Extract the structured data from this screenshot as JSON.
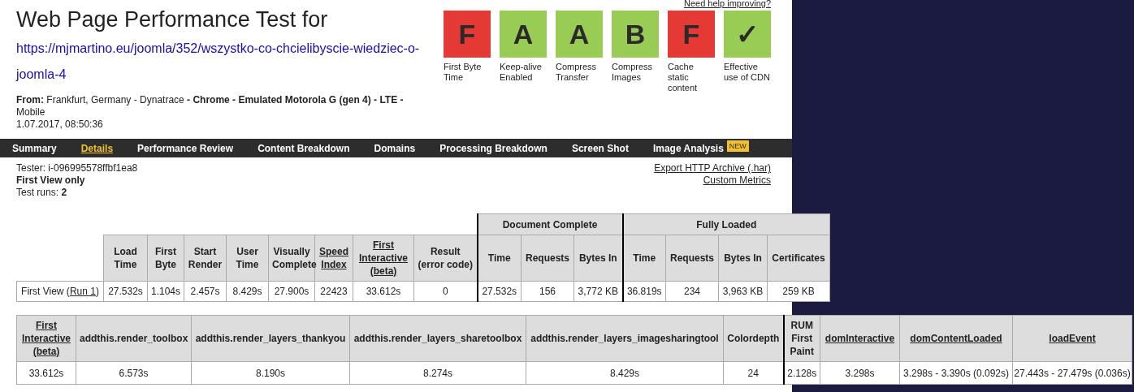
{
  "title": "Web Page Performance Test for",
  "url": "https://mjmartino.eu/joomla/352/wszystko-co-chcielibyscie-wiedziec-o-joomla-4",
  "help_link": "Need help improving?",
  "from": {
    "label": "From:",
    "location": "Frankfurt, Germany - Dynatrace",
    "sep": "-",
    "browser": "Chrome - Emulated Motorola G (gen 4) - LTE -",
    "device": "Mobile",
    "date": "1.07.2017, 08:50:36"
  },
  "grades": [
    {
      "grade": "F",
      "label": "First Byte Time",
      "color": "#e53935"
    },
    {
      "grade": "A",
      "label": "Keep-alive Enabled",
      "color": "#99cc55"
    },
    {
      "grade": "A",
      "label": "Compress Transfer",
      "color": "#99cc55"
    },
    {
      "grade": "B",
      "label": "Compress Images",
      "color": "#99cc55"
    },
    {
      "grade": "F",
      "label": "Cache static content",
      "color": "#e53935"
    },
    {
      "grade": "✓",
      "label": "Effective use of CDN",
      "color": "#99cc55"
    }
  ],
  "tabs": [
    {
      "label": "Summary",
      "selected": false
    },
    {
      "label": "Details",
      "selected": true
    },
    {
      "label": "Performance Review",
      "selected": false
    },
    {
      "label": "Content Breakdown",
      "selected": false
    },
    {
      "label": "Domains",
      "selected": false
    },
    {
      "label": "Processing Breakdown",
      "selected": false
    },
    {
      "label": "Screen Shot",
      "selected": false
    },
    {
      "label": "Image Analysis",
      "selected": false,
      "badge": "NEW"
    }
  ],
  "info": {
    "tester_label": "Tester:",
    "tester": "i-096995578ffbf1ea8",
    "view": "First View only",
    "runs_label": "Test runs:",
    "runs": "2"
  },
  "links": [
    "Export HTTP Archive (.har)",
    "Custom Metrics"
  ],
  "summary_table": {
    "groups": [
      {
        "label": "Document Complete"
      },
      {
        "label": "Fully Loaded"
      }
    ],
    "columns": [
      {
        "label": "Load Time",
        "link": false,
        "divider_before": false
      },
      {
        "label": "First Byte",
        "link": false,
        "divider_before": false
      },
      {
        "label": "Start Render",
        "link": false,
        "divider_before": false
      },
      {
        "label": "User Time",
        "link": false,
        "divider_before": false
      },
      {
        "label": "Visually Complete",
        "link": false,
        "divider_before": false
      },
      {
        "label": "Speed Index",
        "link": true,
        "divider_before": false
      },
      {
        "label": "First Interactive (beta)",
        "link": true,
        "divider_before": false
      },
      {
        "label": "Result (error code)",
        "link": false,
        "divider_before": false
      },
      {
        "label": "Time",
        "link": false,
        "divider_before": true
      },
      {
        "label": "Requests",
        "link": false,
        "divider_before": false
      },
      {
        "label": "Bytes In",
        "link": false,
        "divider_before": false
      },
      {
        "label": "Time",
        "link": false,
        "divider_before": true
      },
      {
        "label": "Requests",
        "link": false,
        "divider_before": false
      },
      {
        "label": "Bytes In",
        "link": false,
        "divider_before": false
      },
      {
        "label": "Certificates",
        "link": false,
        "divider_before": false
      }
    ],
    "rows": [
      {
        "label_before": "First View (",
        "run_link": "Run 1",
        "label_after": ")",
        "cells": [
          "27.532s",
          "1.104s",
          "2.457s",
          "8.429s",
          "27.900s",
          "22423",
          "33.612s",
          "0",
          "27.532s",
          "156",
          "3,772 KB",
          "36.819s",
          "234",
          "3,963 KB",
          "259 KB"
        ]
      }
    ]
  },
  "metrics_table": {
    "columns": [
      {
        "label": "First Interactive (beta)",
        "link": true,
        "divider_before": false
      },
      {
        "label": "addthis.render_toolbox",
        "link": false,
        "divider_before": false
      },
      {
        "label": "addthis.render_layers_thankyou",
        "link": false,
        "divider_before": false
      },
      {
        "label": "addthis.render_layers_sharetoolbox",
        "link": false,
        "divider_before": false
      },
      {
        "label": "addthis.render_layers_imagesharingtool",
        "link": false,
        "divider_before": false
      },
      {
        "label": "Colordepth",
        "link": false,
        "divider_before": false
      },
      {
        "label": "RUM First Paint",
        "link": false,
        "divider_before": true
      },
      {
        "label": "domInteractive",
        "link": true,
        "divider_before": false
      },
      {
        "label": "domContentLoaded",
        "link": true,
        "divider_before": false
      },
      {
        "label": "loadEvent",
        "link": true,
        "divider_before": false
      }
    ],
    "rows": [
      {
        "cells": [
          "33.612s",
          "6.573s",
          "8.190s",
          "8.274s",
          "8.429s",
          "24",
          "2.128s",
          "3.298s",
          "3.298s - 3.390s (0.092s)",
          "27.443s - 27.479s (0.036s)"
        ]
      }
    ]
  }
}
